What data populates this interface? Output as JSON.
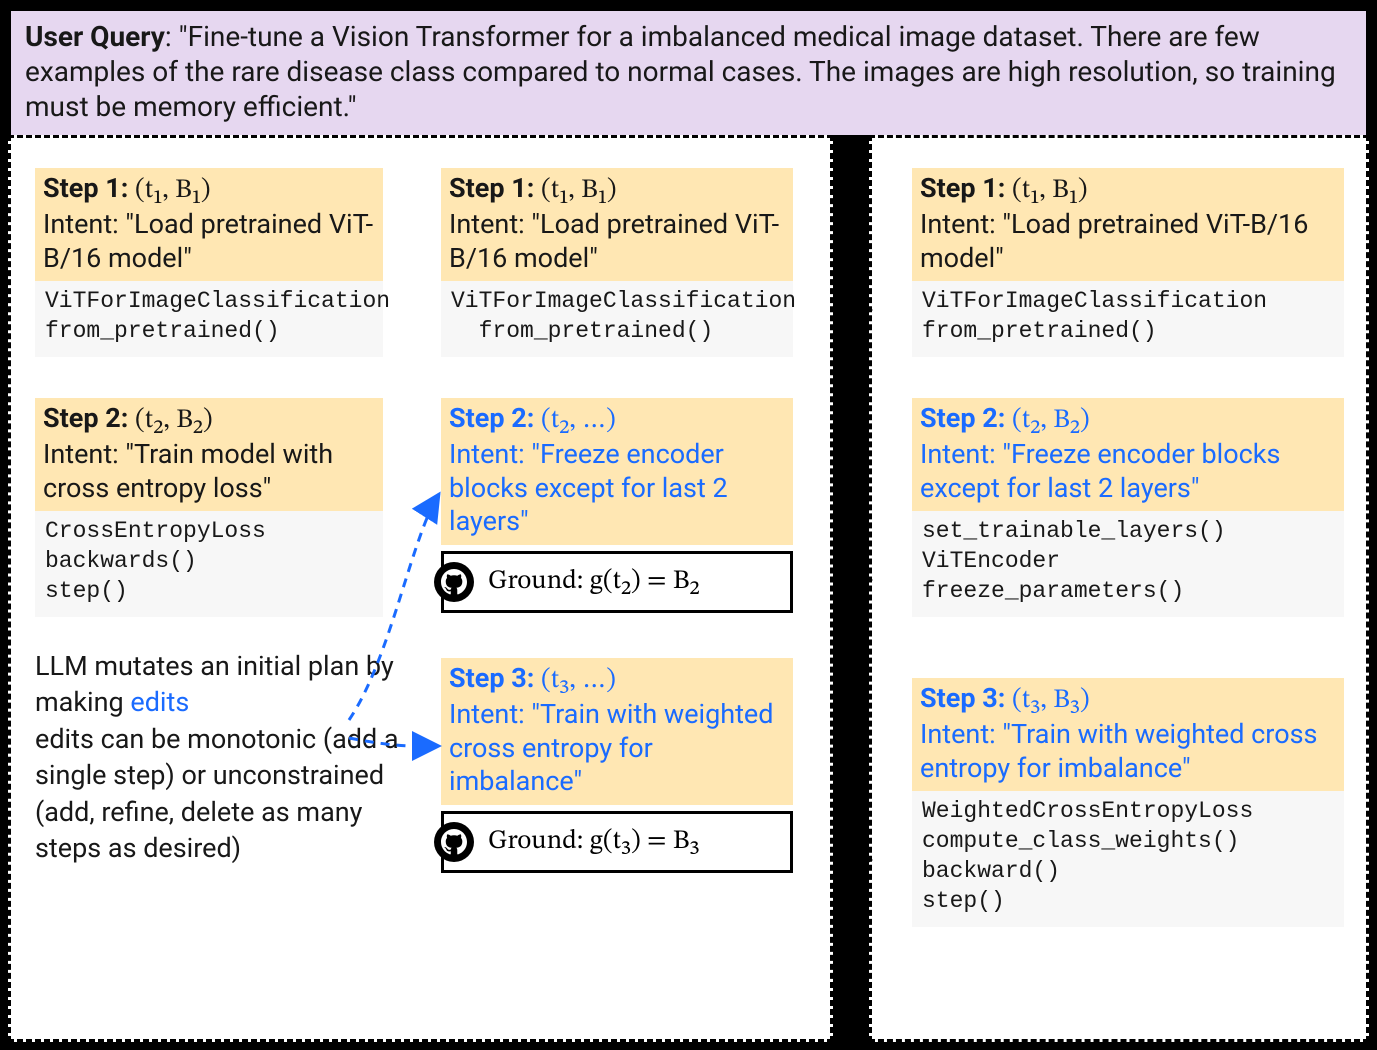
{
  "query": {
    "label": "User Query",
    "text": "\"Fine-tune a Vision Transformer for a imbalanced medical image dataset.  There are few examples of the rare disease class compared to normal cases.  The images are high resolution, so training must be memory efficient.\""
  },
  "left": {
    "colA": {
      "step1": {
        "label": "Step 1:",
        "math": "(t₁, B₁)",
        "intent_prefix": "Intent: ",
        "intent": "\"Load pretrained ViT-B/16 model\"",
        "code": "ViTForImageClassification\nfrom_pretrained()"
      },
      "step2": {
        "label": "Step 2:",
        "math": "(t₂, B₂)",
        "intent_prefix": "Intent: ",
        "intent": "\"Train model with cross entropy loss\"",
        "code": "CrossEntropyLoss\nbackwards()\nstep()"
      },
      "mutation": {
        "line1": "LLM mutates an initial plan by making ",
        "edits": "edits",
        "line2": "edits can be monotonic (add a single step) or unconstrained (add, refine, delete as many steps as desired)"
      }
    },
    "colB": {
      "step1": {
        "label": "Step 1:",
        "math": "(t₁, B₁)",
        "intent_prefix": "Intent: ",
        "intent": "\"Load pretrained ViT-B/16 model\"",
        "code": "ViTForImageClassification\n  from_pretrained()"
      },
      "step2": {
        "label": "Step 2:",
        "math": "(t₂, …)",
        "intent_prefix": "Intent: ",
        "intent": "\"Freeze encoder blocks except for last 2 layers\"",
        "ground": "Ground: g(t₂) = B₂"
      },
      "step3": {
        "label": "Step 3:",
        "math": "(t₃, …)",
        "intent_prefix": "Intent: ",
        "intent": "\"Train with weighted cross entropy for imbalance\"",
        "ground": "Ground: g(t₃) = B₃"
      }
    }
  },
  "right": {
    "step1": {
      "label": "Step 1:",
      "math": "(t₁, B₁)",
      "intent_prefix": "Intent: ",
      "intent": "\"Load pretrained ViT-B/16 model\"",
      "code": "ViTForImageClassification\nfrom_pretrained()"
    },
    "step2": {
      "label": "Step 2:",
      "math": "(t₂, B₂)",
      "intent_prefix": "Intent: ",
      "intent": "\"Freeze encoder blocks except for last 2 layers\"",
      "code": "set_trainable_layers()\nViTEncoder\nfreeze_parameters()"
    },
    "step3": {
      "label": "Step 3:",
      "math": "(t₃, B₃)",
      "intent_prefix": "Intent: ",
      "intent": "\"Train with weighted cross entropy for imbalance\"",
      "code": "WeightedCrossEntropyLoss\ncompute_class_weights()\nbackward()\nstep()"
    }
  }
}
